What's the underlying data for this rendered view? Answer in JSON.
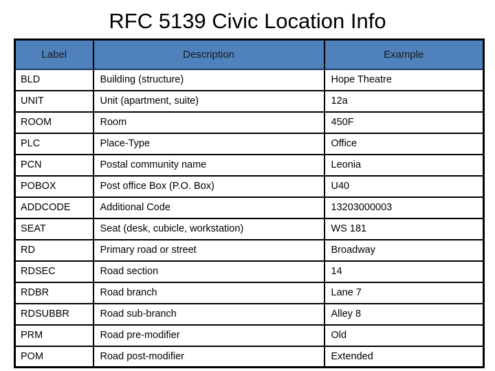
{
  "slide": {
    "title": "RFC 5139 Civic Location Info"
  },
  "colors": {
    "header_fill": "#4F81BD",
    "header_bottom_border": "#17375E",
    "grid_line": "#000000",
    "page_background": "#FFFFFF",
    "text": "#000000"
  },
  "table": {
    "columns": [
      {
        "key": "label",
        "header": "Label"
      },
      {
        "key": "description",
        "header": "Description"
      },
      {
        "key": "example",
        "header": "Example"
      }
    ],
    "rows": [
      {
        "label": "BLD",
        "description": "Building (structure)",
        "example": "Hope Theatre"
      },
      {
        "label": "UNIT",
        "description": "Unit (apartment, suite)",
        "example": "12a"
      },
      {
        "label": "ROOM",
        "description": "Room",
        "example": "450F"
      },
      {
        "label": "PLC",
        "description": "Place-Type",
        "example": "Office"
      },
      {
        "label": "PCN",
        "description": "Postal community name",
        "example": "Leonia"
      },
      {
        "label": "POBOX",
        "description": "Post office Box (P.O. Box)",
        "example": "U40"
      },
      {
        "label": "ADDCODE",
        "description": "Additional Code",
        "example": "13203000003"
      },
      {
        "label": "SEAT",
        "description": "Seat (desk, cubicle, workstation)",
        "example": "WS 181"
      },
      {
        "label": "RD",
        "description": "Primary road or street",
        "example": "Broadway"
      },
      {
        "label": "RDSEC",
        "description": "Road section",
        "example": "14"
      },
      {
        "label": "RDBR",
        "description": "Road branch",
        "example": "Lane 7"
      },
      {
        "label": "RDSUBBR",
        "description": "Road sub-branch",
        "example": "Alley 8"
      },
      {
        "label": "PRM",
        "description": "Road pre-modifier",
        "example": "Old"
      },
      {
        "label": "POM",
        "description": "Road post-modifier",
        "example": "Extended"
      }
    ]
  }
}
